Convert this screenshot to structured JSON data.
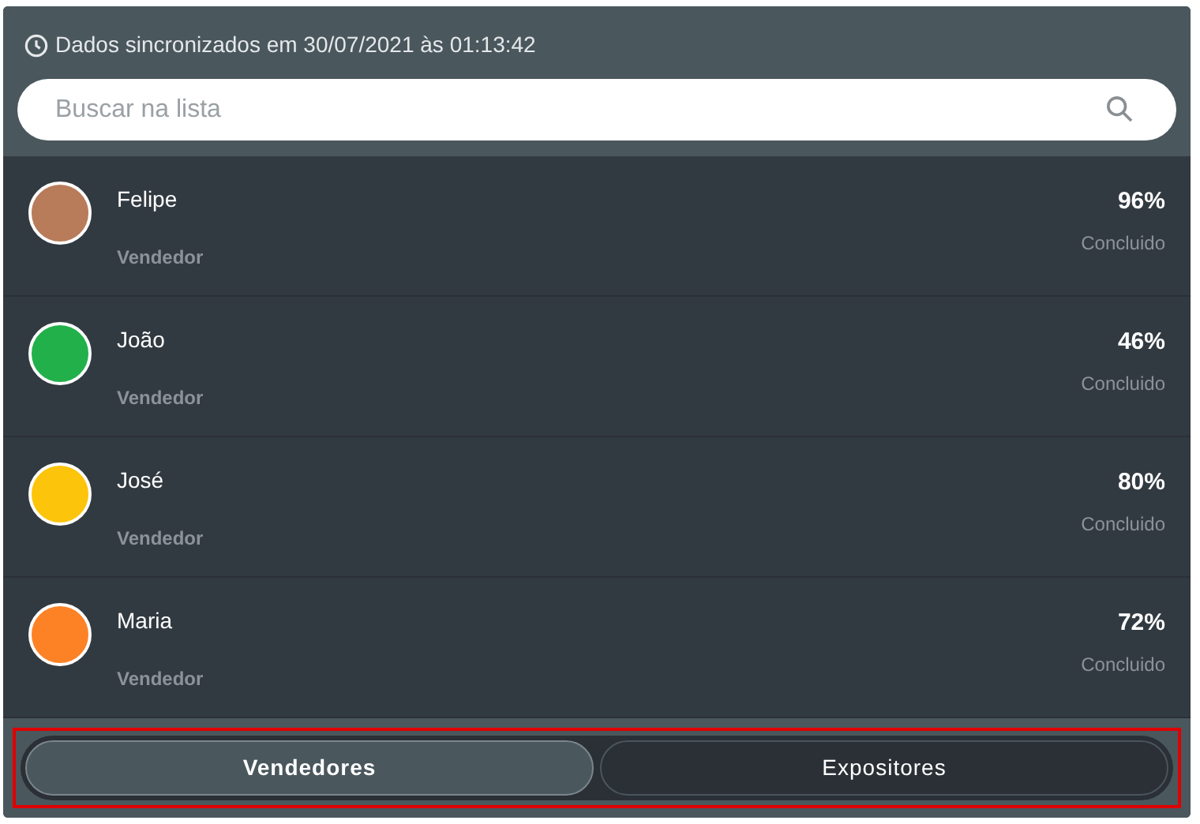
{
  "sync_status": "Dados sincronizados em 30/07/2021 às 01:13:42",
  "search": {
    "placeholder": "Buscar na lista"
  },
  "people": [
    {
      "name": "Felipe",
      "role": "Vendedor",
      "percent": "96%",
      "status": "Concluido",
      "color": "#b87c5a"
    },
    {
      "name": "João",
      "role": "Vendedor",
      "percent": "46%",
      "status": "Concluido",
      "color": "#22b04b"
    },
    {
      "name": "José",
      "role": "Vendedor",
      "percent": "80%",
      "status": "Concluido",
      "color": "#fcc40a"
    },
    {
      "name": "Maria",
      "role": "Vendedor",
      "percent": "72%",
      "status": "Concluido",
      "color": "#fd8226"
    }
  ],
  "tabs": [
    {
      "label": "Vendedores",
      "selected": true
    },
    {
      "label": "Expositores",
      "selected": false
    }
  ]
}
